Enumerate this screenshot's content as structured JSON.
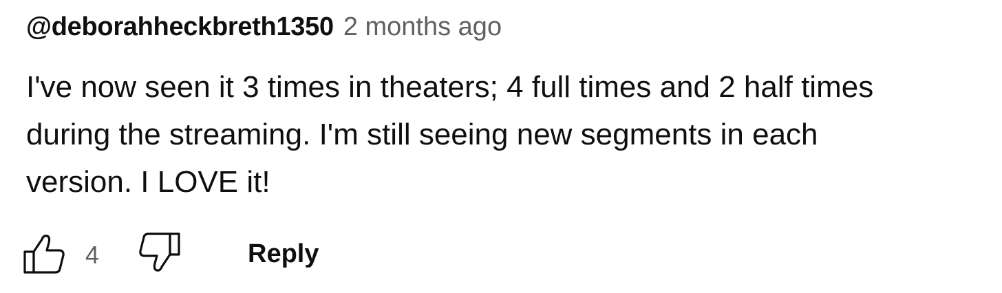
{
  "comment": {
    "author": "@deborahheckbreth1350",
    "timestamp": "2 months ago",
    "text": "I've now seen it 3 times in theaters; 4 full times and 2 half times\nduring the streaming. I'm still seeing new segments in each\nversion. I LOVE it!"
  },
  "actions": {
    "like_icon": "thumbs-up-icon",
    "like_count": "4",
    "dislike_icon": "thumbs-down-icon",
    "reply_label": "Reply"
  },
  "colors": {
    "text_primary": "#0f0f0f",
    "text_secondary": "#606060",
    "background": "#ffffff"
  }
}
